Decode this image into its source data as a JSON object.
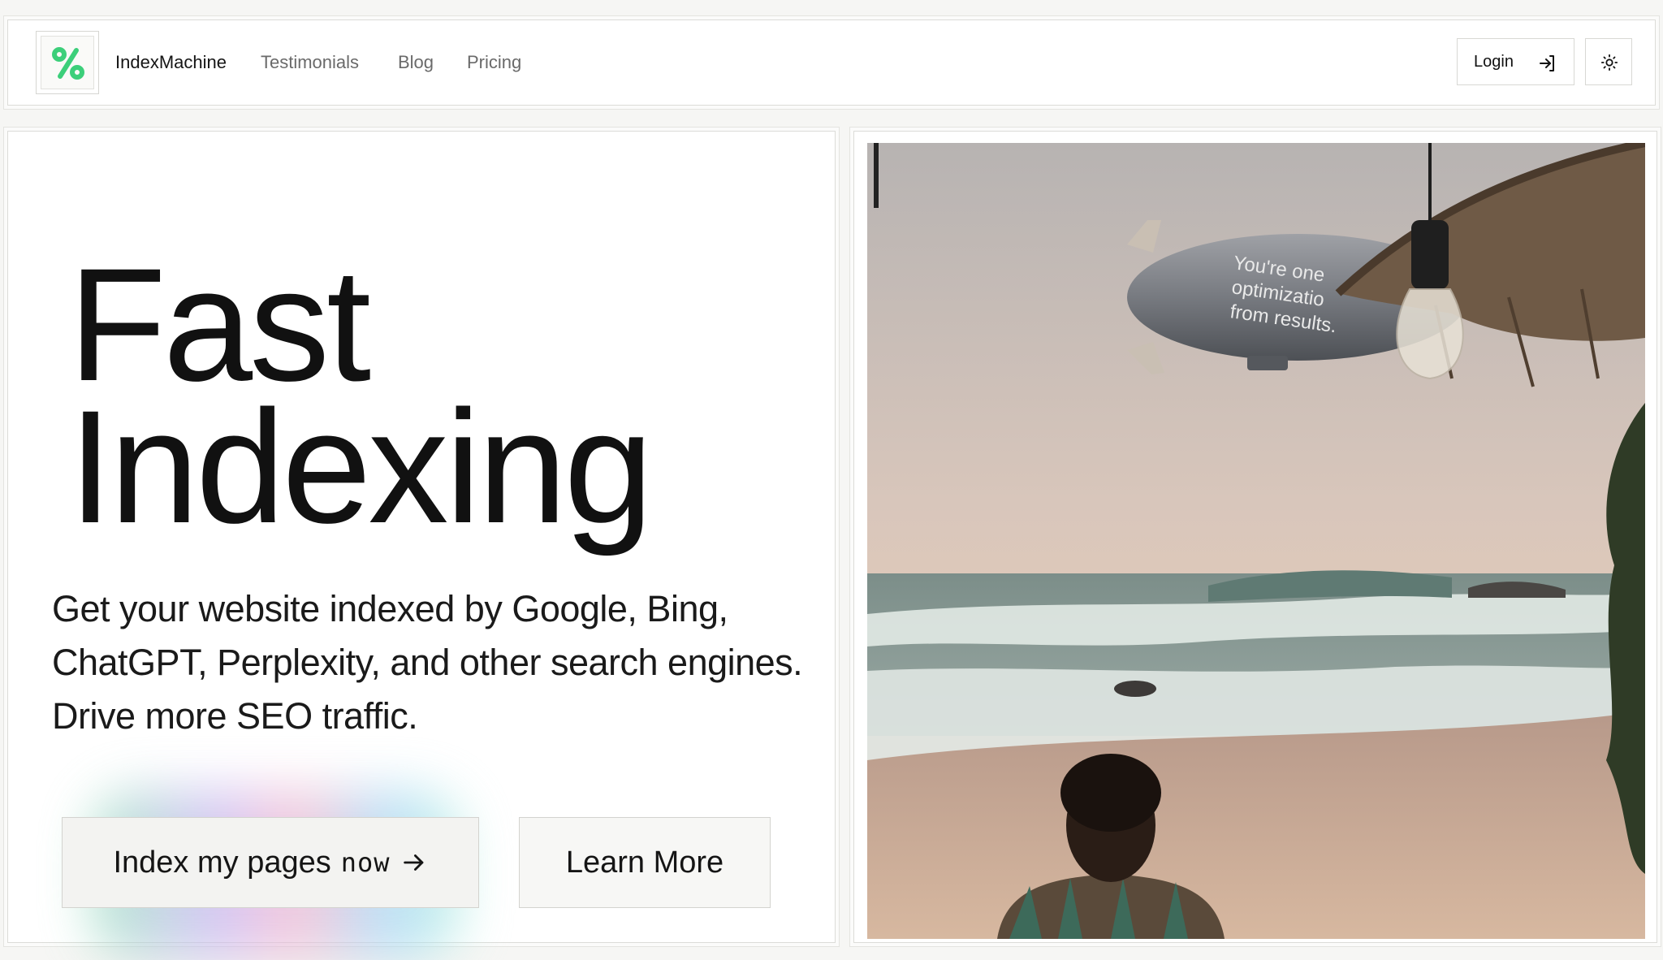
{
  "nav": {
    "brand": "IndexMachine",
    "links": [
      "Testimonials",
      "Blog",
      "Pricing"
    ],
    "login_label": "Login"
  },
  "hero": {
    "headline_line1": "Fast",
    "headline_line2": "Indexing",
    "subtext": "Get your website indexed by Google, Bing, ChatGPT, Perplexity, and other search engines. Drive more SEO traffic.",
    "cta_primary": "Index my pages",
    "cta_primary_mono": "now",
    "cta_secondary": "Learn More"
  },
  "image": {
    "blimp_text_1": "You're one",
    "blimp_text_2": "optimizatio",
    "blimp_text_3": "from results."
  },
  "colors": {
    "accent": "#3ccf7a",
    "text": "#121212",
    "muted": "#6a6a6a",
    "border": "#d8d8d4"
  },
  "icons": [
    "logo-icon",
    "login-arrow-icon",
    "sun-icon",
    "arrow-right-icon"
  ]
}
